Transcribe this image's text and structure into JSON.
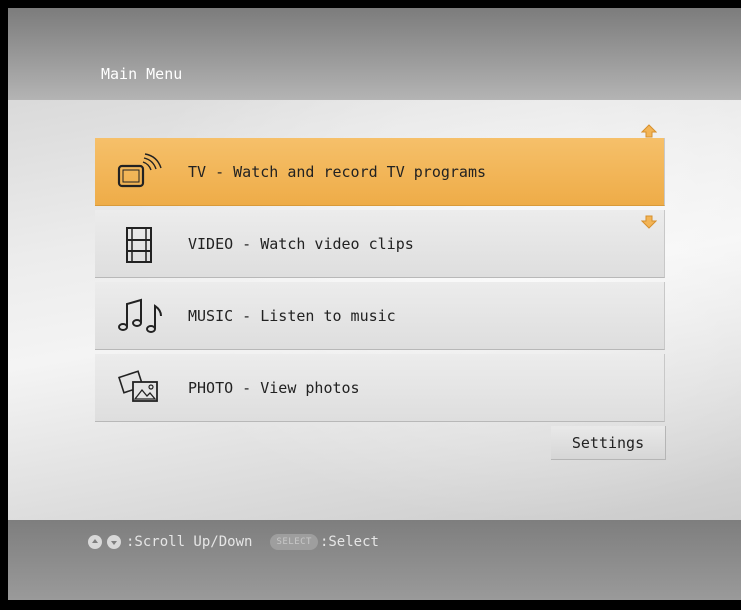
{
  "header": {
    "title": "Main Menu"
  },
  "menu": {
    "items": [
      {
        "label": "TV - Watch and record TV programs",
        "icon": "tv-icon",
        "selected": true
      },
      {
        "label": "VIDEO - Watch video clips",
        "icon": "film-icon",
        "selected": false
      },
      {
        "label": "MUSIC - Listen to music",
        "icon": "music-note-icon",
        "selected": false
      },
      {
        "label": "PHOTO - View photos",
        "icon": "photo-icon",
        "selected": false
      }
    ],
    "scroll_up_icon": "arrow-up-icon",
    "scroll_down_icon": "arrow-down-icon"
  },
  "settings": {
    "label": "Settings"
  },
  "footer": {
    "scroll_hint": ":Scroll Up/Down",
    "select_button": "SELECT",
    "select_hint": ":Select"
  },
  "colors": {
    "selected_bg": "#F2B456",
    "scroll_arrow": "#F2B456",
    "item_bg": "#E4E4E4",
    "band_bg": "#8A8A8A"
  }
}
